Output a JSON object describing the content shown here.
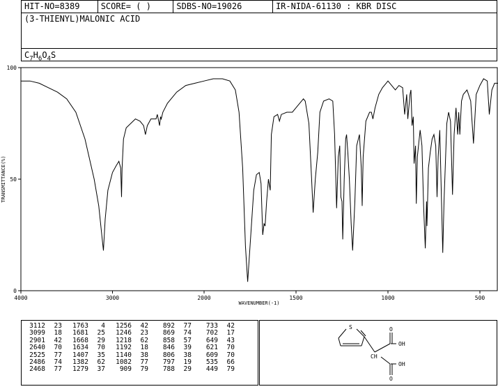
{
  "header": {
    "hit_no": "HIT-NO=8389",
    "score": "SCORE=  (   )",
    "sdbs_no": "SDBS-NO=19026",
    "ir_info": "IR-NIDA-61130 : KBR DISC",
    "compound_name": "(3-THIENYL)MALONIC ACID",
    "formula_prefix": "C",
    "formula_c": "7",
    "formula_h_prefix": "H",
    "formula_h": "6",
    "formula_o_prefix": "O",
    "formula_o": "4",
    "formula_s": "S"
  },
  "chart_data": {
    "type": "line",
    "title": "",
    "xlabel": "WAVENUMBER(-1)",
    "ylabel": "TRANSMITTANCE(%)",
    "xlim": [
      4000,
      400
    ],
    "ylim": [
      0,
      100
    ],
    "x_ticks": [
      "4000",
      "3000",
      "2000",
      "1500",
      "1000",
      "500"
    ],
    "y_ticks": [
      "100",
      "50",
      "0"
    ],
    "series": [
      {
        "points": [
          [
            4000,
            94
          ],
          [
            3900,
            94
          ],
          [
            3800,
            93
          ],
          [
            3700,
            91
          ],
          [
            3600,
            89
          ],
          [
            3500,
            86
          ],
          [
            3400,
            80
          ],
          [
            3300,
            68
          ],
          [
            3200,
            50
          ],
          [
            3150,
            38
          ],
          [
            3112,
            23
          ],
          [
            3099,
            18
          ],
          [
            3080,
            32
          ],
          [
            3050,
            45
          ],
          [
            3000,
            53
          ],
          [
            2960,
            56
          ],
          [
            2930,
            58
          ],
          [
            2910,
            55
          ],
          [
            2901,
            42
          ],
          [
            2895,
            55
          ],
          [
            2880,
            68
          ],
          [
            2850,
            73
          ],
          [
            2800,
            75
          ],
          [
            2750,
            77
          ],
          [
            2700,
            76
          ],
          [
            2660,
            74
          ],
          [
            2640,
            70
          ],
          [
            2620,
            74
          ],
          [
            2580,
            77
          ],
          [
            2540,
            77
          ],
          [
            2525,
            77
          ],
          [
            2510,
            79
          ],
          [
            2486,
            74
          ],
          [
            2475,
            78
          ],
          [
            2468,
            77
          ],
          [
            2450,
            80
          ],
          [
            2400,
            84
          ],
          [
            2300,
            89
          ],
          [
            2200,
            92
          ],
          [
            2100,
            93
          ],
          [
            2000,
            94
          ],
          [
            1950,
            95
          ],
          [
            1900,
            95
          ],
          [
            1860,
            94
          ],
          [
            1830,
            90
          ],
          [
            1810,
            80
          ],
          [
            1790,
            55
          ],
          [
            1775,
            20
          ],
          [
            1763,
            4
          ],
          [
            1750,
            20
          ],
          [
            1730,
            45
          ],
          [
            1715,
            52
          ],
          [
            1700,
            53
          ],
          [
            1690,
            48
          ],
          [
            1681,
            25
          ],
          [
            1674,
            30
          ],
          [
            1668,
            29
          ],
          [
            1660,
            40
          ],
          [
            1650,
            50
          ],
          [
            1640,
            45
          ],
          [
            1634,
            70
          ],
          [
            1620,
            78
          ],
          [
            1600,
            79
          ],
          [
            1590,
            76
          ],
          [
            1580,
            79
          ],
          [
            1550,
            80
          ],
          [
            1520,
            80
          ],
          [
            1500,
            82
          ],
          [
            1480,
            84
          ],
          [
            1460,
            86
          ],
          [
            1450,
            85
          ],
          [
            1430,
            75
          ],
          [
            1415,
            50
          ],
          [
            1407,
            35
          ],
          [
            1395,
            50
          ],
          [
            1382,
            62
          ],
          [
            1370,
            80
          ],
          [
            1350,
            85
          ],
          [
            1320,
            86
          ],
          [
            1300,
            85
          ],
          [
            1290,
            70
          ],
          [
            1279,
            37
          ],
          [
            1270,
            60
          ],
          [
            1262,
            65
          ],
          [
            1256,
            42
          ],
          [
            1250,
            40
          ],
          [
            1246,
            23
          ],
          [
            1238,
            50
          ],
          [
            1230,
            68
          ],
          [
            1225,
            70
          ],
          [
            1218,
            62
          ],
          [
            1210,
            50
          ],
          [
            1200,
            30
          ],
          [
            1192,
            18
          ],
          [
            1180,
            40
          ],
          [
            1170,
            65
          ],
          [
            1155,
            70
          ],
          [
            1145,
            55
          ],
          [
            1140,
            38
          ],
          [
            1135,
            60
          ],
          [
            1120,
            76
          ],
          [
            1100,
            80
          ],
          [
            1090,
            80
          ],
          [
            1082,
            77
          ],
          [
            1070,
            82
          ],
          [
            1050,
            88
          ],
          [
            1030,
            91
          ],
          [
            1010,
            93
          ],
          [
            1000,
            94
          ],
          [
            980,
            92
          ],
          [
            960,
            90
          ],
          [
            940,
            92
          ],
          [
            920,
            91
          ],
          [
            909,
            79
          ],
          [
            898,
            88
          ],
          [
            892,
            77
          ],
          [
            880,
            88
          ],
          [
            875,
            90
          ],
          [
            869,
            74
          ],
          [
            862,
            78
          ],
          [
            858,
            57
          ],
          [
            850,
            65
          ],
          [
            846,
            39
          ],
          [
            840,
            60
          ],
          [
            825,
            72
          ],
          [
            815,
            65
          ],
          [
            806,
            38
          ],
          [
            797,
            19
          ],
          [
            790,
            40
          ],
          [
            788,
            29
          ],
          [
            780,
            55
          ],
          [
            770,
            62
          ],
          [
            760,
            68
          ],
          [
            750,
            70
          ],
          [
            740,
            65
          ],
          [
            733,
            42
          ],
          [
            727,
            60
          ],
          [
            718,
            72
          ],
          [
            702,
            17
          ],
          [
            695,
            40
          ],
          [
            680,
            75
          ],
          [
            670,
            80
          ],
          [
            660,
            76
          ],
          [
            649,
            43
          ],
          [
            640,
            70
          ],
          [
            630,
            82
          ],
          [
            621,
            70
          ],
          [
            615,
            80
          ],
          [
            609,
            70
          ],
          [
            600,
            85
          ],
          [
            590,
            88
          ],
          [
            570,
            90
          ],
          [
            550,
            85
          ],
          [
            535,
            66
          ],
          [
            520,
            88
          ],
          [
            500,
            92
          ],
          [
            480,
            95
          ],
          [
            460,
            94
          ],
          [
            449,
            79
          ],
          [
            435,
            90
          ],
          [
            420,
            93
          ],
          [
            400,
            93
          ]
        ]
      }
    ]
  },
  "peak_table": {
    "rows": [
      [
        "3112",
        "23",
        "1763",
        " 4",
        "1256",
        "42",
        " 892",
        "77",
        " 733",
        "42"
      ],
      [
        "3099",
        "18",
        "1681",
        "25",
        "1246",
        "23",
        " 869",
        "74",
        " 702",
        "17"
      ],
      [
        "2901",
        "42",
        "1668",
        "29",
        "1218",
        "62",
        " 858",
        "57",
        " 649",
        "43"
      ],
      [
        "2640",
        "70",
        "1634",
        "70",
        "1192",
        "18",
        " 846",
        "39",
        " 621",
        "70"
      ],
      [
        "2525",
        "77",
        "1407",
        "35",
        "1140",
        "38",
        " 806",
        "38",
        " 609",
        "70"
      ],
      [
        "2486",
        "74",
        "1382",
        "62",
        "1082",
        "77",
        " 797",
        "19",
        " 535",
        "66"
      ],
      [
        "2468",
        "77",
        "1279",
        "37",
        " 909",
        "79",
        " 788",
        "29",
        " 449",
        "79"
      ]
    ]
  },
  "structure": {
    "labels": {
      "S": "S",
      "O1": "O",
      "OH1": "OH",
      "CH": "CH",
      "O2": "O",
      "OH2": "OH"
    }
  }
}
